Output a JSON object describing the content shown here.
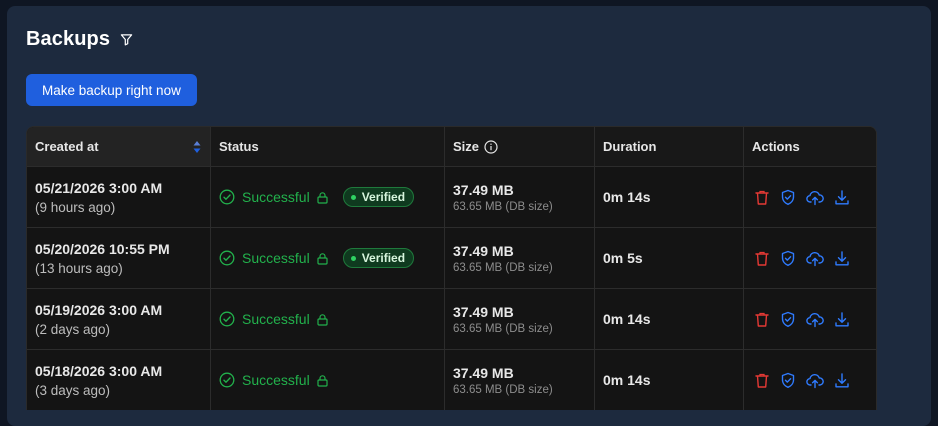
{
  "page": {
    "title": "Backups",
    "filter_icon": "filter-icon",
    "backup_button_label": "Make backup right now"
  },
  "table": {
    "headers": {
      "created_at": "Created at",
      "status": "Status",
      "size": "Size",
      "duration": "Duration",
      "actions": "Actions"
    },
    "rows": [
      {
        "date": "05/21/2026 3:00 AM",
        "ago": "(9 hours ago)",
        "status": "Successful",
        "verified": "Verified",
        "size": "37.49 MB",
        "db_size": "63.65 MB (DB size)",
        "duration": "0m 14s"
      },
      {
        "date": "05/20/2026 10:55 PM",
        "ago": "(13 hours ago)",
        "status": "Successful",
        "verified": "Verified",
        "size": "37.49 MB",
        "db_size": "63.65 MB (DB size)",
        "duration": "0m 5s"
      },
      {
        "date": "05/19/2026 3:00 AM",
        "ago": "(2 days ago)",
        "status": "Successful",
        "verified": "",
        "size": "37.49 MB",
        "db_size": "63.65 MB (DB size)",
        "duration": "0m 14s"
      },
      {
        "date": "05/18/2026 3:00 AM",
        "ago": "(3 days ago)",
        "status": "Successful",
        "verified": "",
        "size": "37.49 MB",
        "db_size": "63.65 MB (DB size)",
        "duration": "0m 14s"
      }
    ]
  },
  "colors": {
    "panel": "#1d2a3e",
    "accent": "#1f5fde",
    "success": "#22b14c",
    "danger": "#e53935",
    "action_blue": "#2f7bff"
  }
}
